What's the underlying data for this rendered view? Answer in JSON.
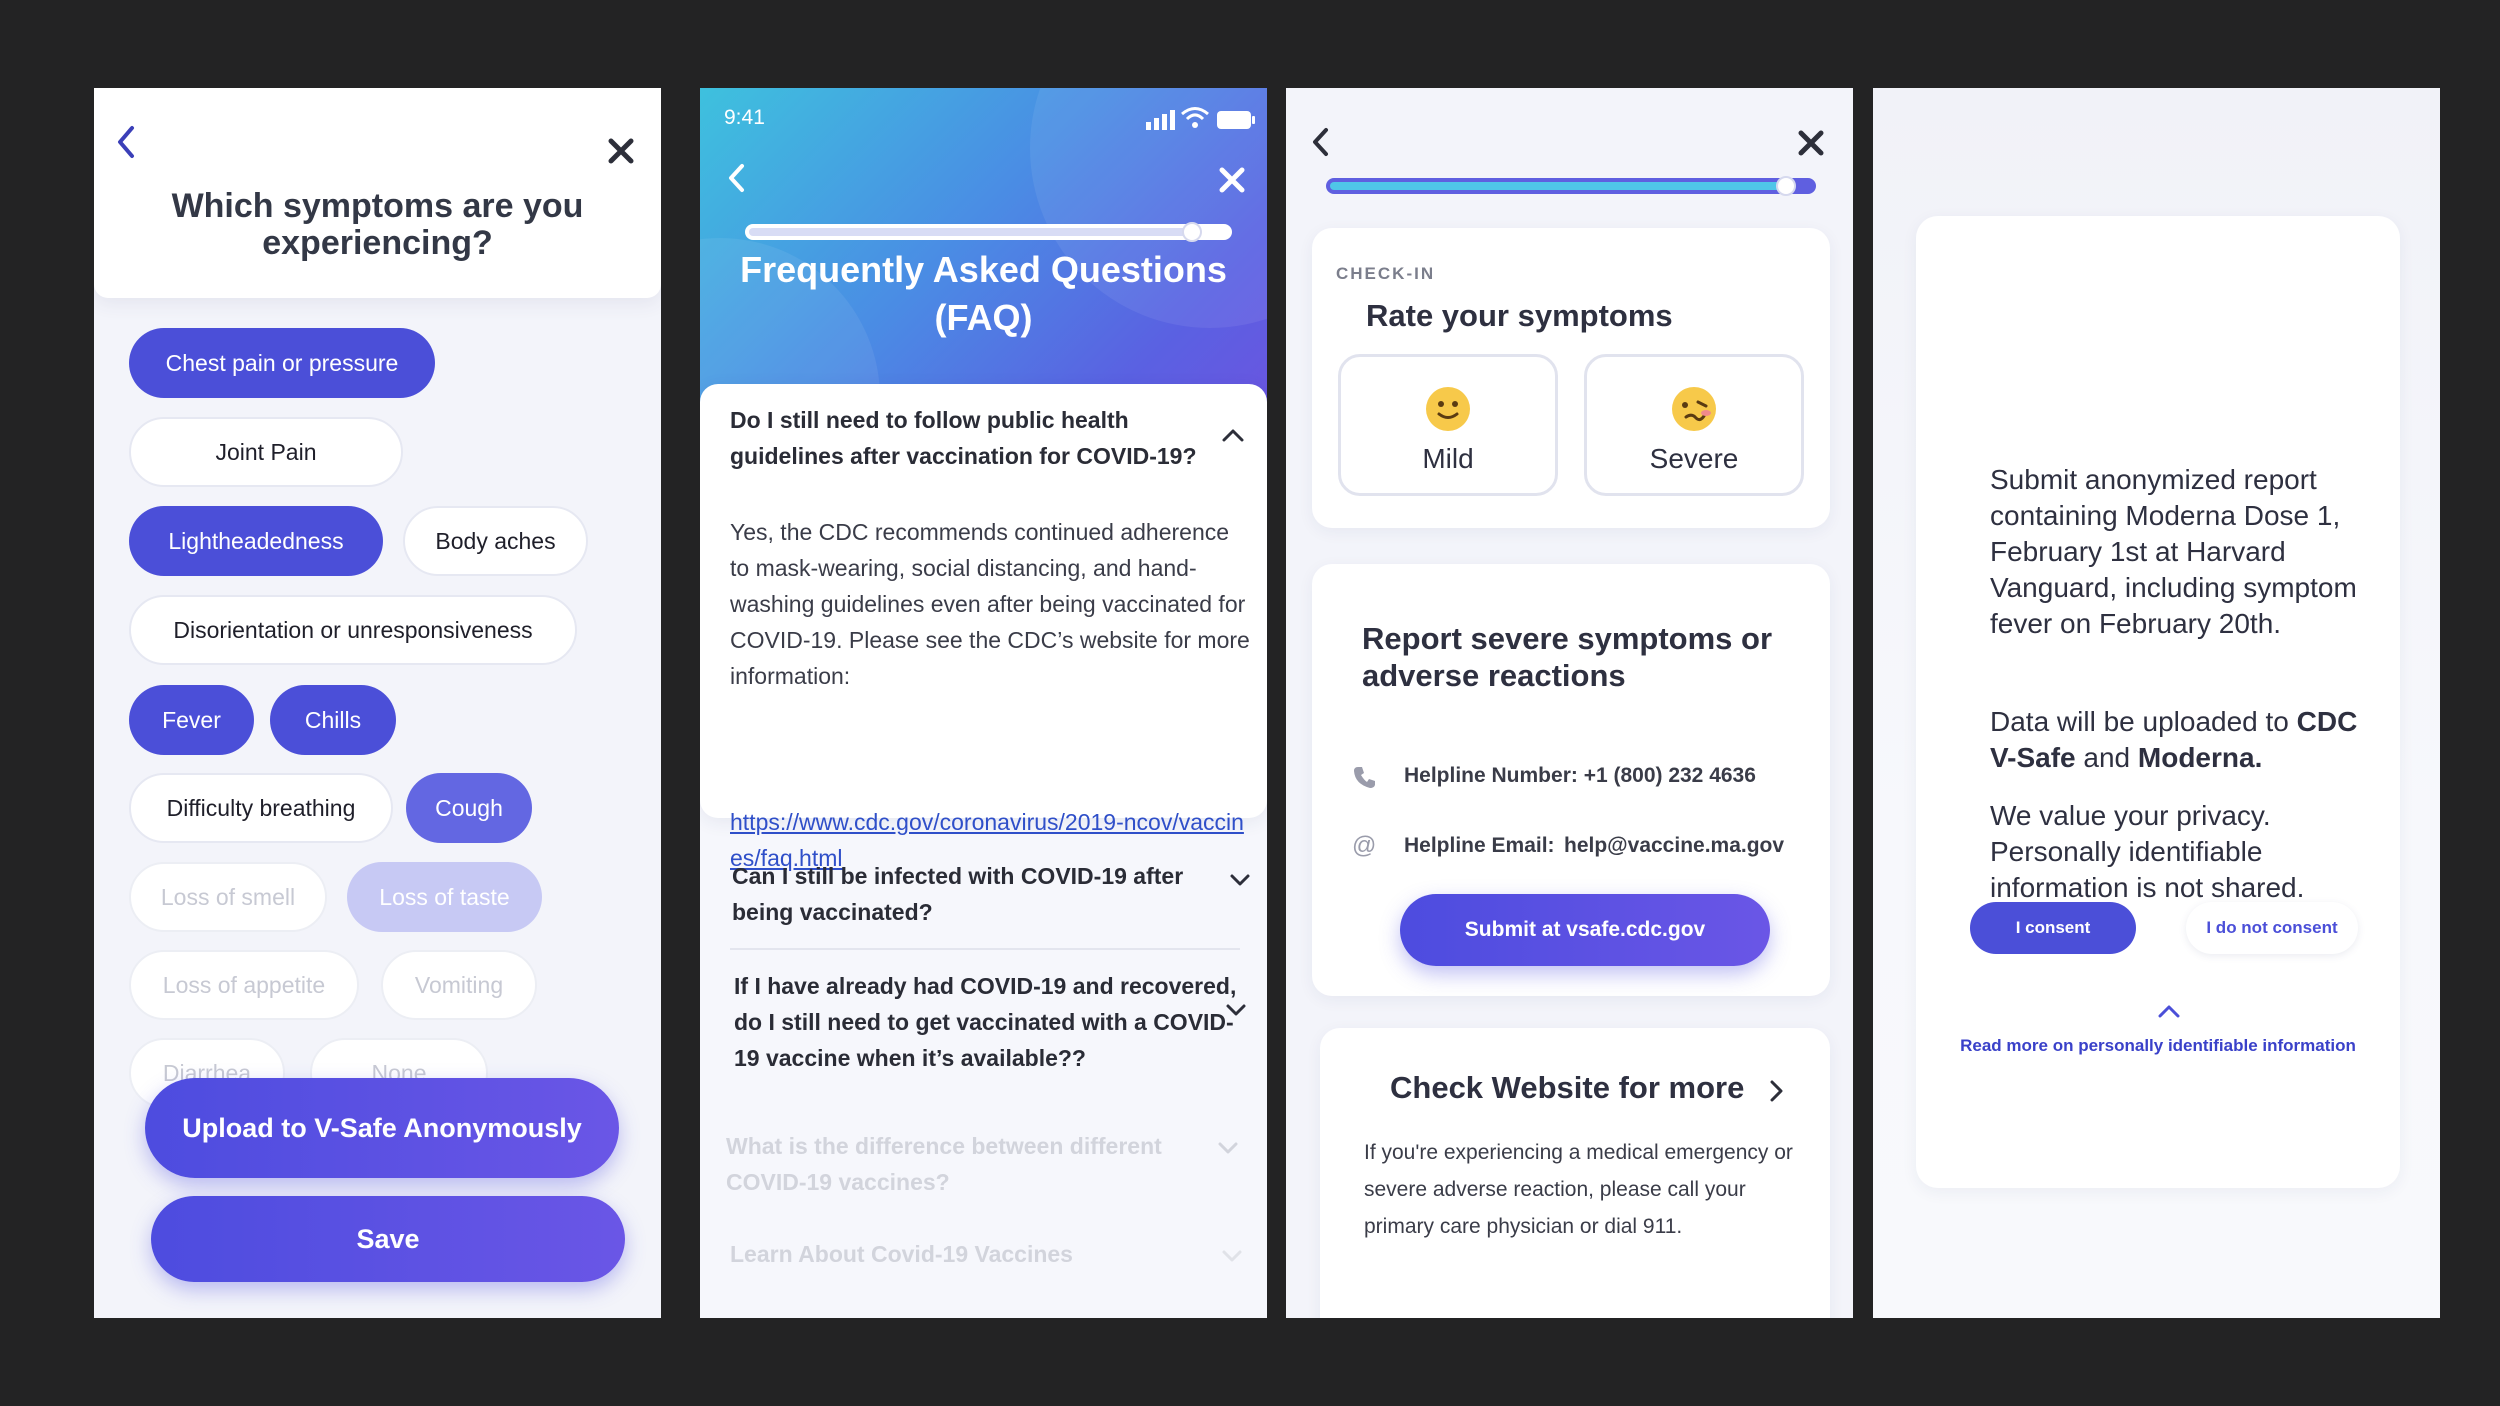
{
  "screen1": {
    "title": "Which symptoms are you experiencing?",
    "chips": [
      {
        "label": "Chest pain or pressure",
        "state": "selected"
      },
      {
        "label": "Joint Pain",
        "state": "unselected"
      },
      {
        "label": "Lightheadedness",
        "state": "selected"
      },
      {
        "label": "Body aches",
        "state": "unselected"
      },
      {
        "label": "Disorientation or unresponsiveness",
        "state": "unselected"
      },
      {
        "label": "Fever",
        "state": "selected"
      },
      {
        "label": "Chills",
        "state": "selected"
      },
      {
        "label": "Difficulty breathing",
        "state": "unselected"
      },
      {
        "label": "Cough",
        "state": "selected"
      },
      {
        "label": "Loss of smell",
        "state": "faded"
      },
      {
        "label": "Loss of taste",
        "state": "faded-selected"
      },
      {
        "label": "Loss of appetite",
        "state": "faded"
      },
      {
        "label": "Vomiting",
        "state": "faded"
      },
      {
        "label": "Diarrhea",
        "state": "faded"
      },
      {
        "label": "None",
        "state": "faded"
      }
    ],
    "upload_label": "Upload to V-Safe Anonymously",
    "save_label": "Save",
    "icons": {
      "back": "chevron-left-icon",
      "close": "close-icon"
    }
  },
  "screen2": {
    "time": "9:41",
    "title": "Frequently Asked Questions (FAQ)",
    "progress": 0.93,
    "faqs": [
      {
        "question": "Do I still need to follow public health guidelines after vaccination for COVID-19?",
        "expanded": true,
        "answer": "Yes, the CDC recommends continued adherence to mask-wearing, social distancing, and hand-washing guidelines even after being vaccinated for COVID-19. Please see the CDC’s website for more information:",
        "link": "https://www.cdc.gov/coronavirus/2019-ncov/vaccines/faq.html"
      },
      {
        "question": "Can I still be infected with COVID-19 after being vaccinated?",
        "expanded": false
      },
      {
        "question": "If I have already had COVID-19 and recovered, do I still need to get vaccinated with a COVID-19 vaccine when it’s available??",
        "expanded": false
      },
      {
        "question": "What is the difference between different COVID-19 vaccines?",
        "expanded": false
      },
      {
        "question": "Learn About Covid-19 Vaccines",
        "expanded": false
      }
    ]
  },
  "screen3": {
    "progress": 0.95,
    "checkin_label": "CHECK-IN",
    "rate_title": "Rate your symptoms",
    "ratings": [
      {
        "label": "Mild",
        "emoji": "slightly-smiling-face"
      },
      {
        "label": "Severe",
        "emoji": "woozy-face"
      }
    ],
    "report_title": "Report severe symptoms or adverse reactions",
    "helpline_number": "Helpline Number: +1 (800) 232 4636",
    "helpline_email_label": "Helpline Email:",
    "helpline_email": "help@vaccine.ma.gov",
    "submit_label": "Submit at vsafe.cdc.gov",
    "website_title": "Check Website for more",
    "website_text": "If you're experiencing a medical emergency or severe adverse reaction, please call your primary care physician or dial 911."
  },
  "screen4": {
    "report_text": "Submit anonymized report containing Moderna Dose 1, February 1st at Harvard Vanguard, including symptom fever on February 20th.",
    "upload_prefix": "Data will be uploaded to ",
    "upload_target_1": "CDC V-Safe",
    "upload_and": " and ",
    "upload_target_2": "Moderna.",
    "privacy_text": "We value your privacy. Personally identifiable information is not shared.",
    "consent_label": "I consent",
    "no_consent_label": "I do not consent",
    "read_more_label": "Read more on personally identifiable information"
  },
  "colors": {
    "accent": "#4b4fd8",
    "background": "#232324",
    "link": "#2f4fc9"
  }
}
